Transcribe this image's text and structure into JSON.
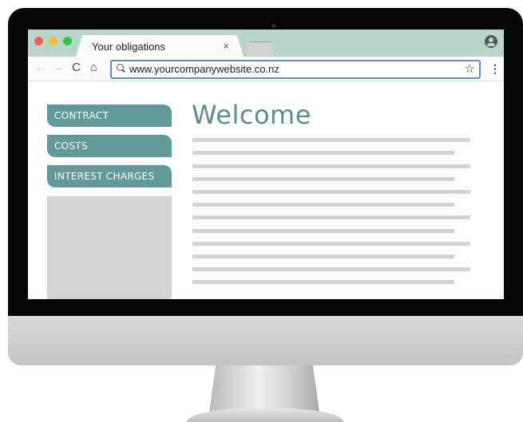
{
  "browser": {
    "tab_title": "Your obligations",
    "tab_close": "×",
    "url": "www.yourcompanywebsite.co.nz",
    "back_glyph": "←",
    "forward_glyph": "→",
    "reload_glyph": "C",
    "home_glyph": "⌂",
    "star_glyph": "☆",
    "menu_glyph": "⋮"
  },
  "page": {
    "heading": "Welcome",
    "nav": [
      {
        "label": "CONTRACT"
      },
      {
        "label": "COSTS"
      },
      {
        "label": "INTEREST CHARGES"
      }
    ]
  },
  "colors": {
    "accent": "#629a9a",
    "heading": "#5a8e8e",
    "tabbar": "#b8d6c9",
    "placeholder": "#d3d3d3"
  }
}
